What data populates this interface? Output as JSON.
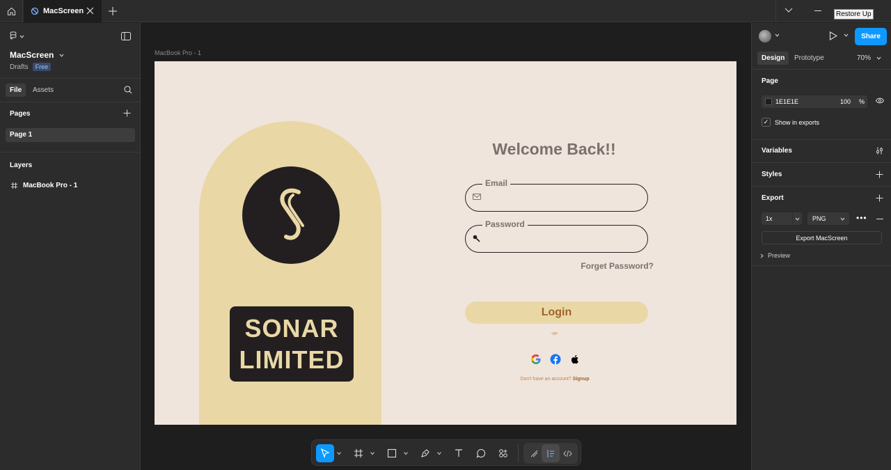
{
  "tabbar": {
    "tab_label": "MacScreen",
    "tooltip": "Restore Up"
  },
  "left_panel": {
    "file_name": "MacScreen",
    "drafts_label": "Drafts",
    "plan_badge": "Free",
    "tabs": [
      "File",
      "Assets"
    ],
    "pages_heading": "Pages",
    "pages": [
      "Page 1"
    ],
    "layers_heading": "Layers",
    "layers": [
      "MacBook Pro - 1"
    ]
  },
  "canvas": {
    "frame_label": "MacBook Pro - 1",
    "design": {
      "brand_line1": "SONAR",
      "brand_line2": "LIMITED",
      "welcome": "Welcome Back!!",
      "email_label": "Email",
      "password_label": "Password",
      "forgot": "Forget Password?",
      "login": "Login",
      "or": "-or-",
      "no_account": "Don't have an account?",
      "signup": "Signup",
      "colors": {
        "background": "#efe5dc",
        "accent": "#e9d8a6",
        "dark": "#231f20",
        "text_muted": "#7a716f",
        "login_text": "#a0622a"
      }
    }
  },
  "toolbar": {
    "tools": [
      "move-tool",
      "frame-tool",
      "shape-tool",
      "pen-tool",
      "text-tool",
      "comment-tool",
      "actions-tool",
      "draw-mode",
      "design-mode",
      "dev-mode"
    ],
    "help": "?"
  },
  "right_panel": {
    "share": "Share",
    "tabs": [
      "Design",
      "Prototype"
    ],
    "zoom": "70%",
    "page_heading": "Page",
    "page_color": "1E1E1E",
    "page_opacity": "100",
    "opacity_unit": "%",
    "show_in_exports": "Show in exports",
    "variables": "Variables",
    "styles": "Styles",
    "export_heading": "Export",
    "export_scale": "1x",
    "export_format": "PNG",
    "export_button": "Export MacScreen",
    "preview": "Preview"
  }
}
